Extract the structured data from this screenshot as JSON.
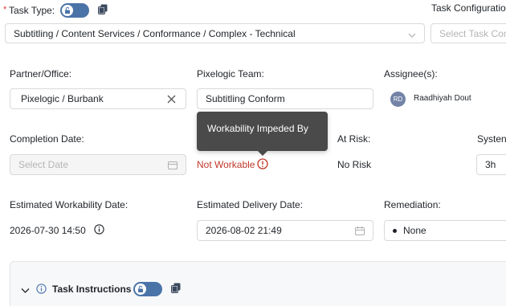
{
  "header": {
    "required_mark": "*",
    "task_type_label": "Task Type:",
    "task_config_label": "Task Configuratio"
  },
  "task_type": {
    "value": "Subtitling / Content Services / Conformance / Complex - Technical"
  },
  "task_config": {
    "placeholder": "Select Task Con"
  },
  "partner": {
    "label": "Partner/Office:",
    "value": "Pixelogic / Burbank"
  },
  "team": {
    "label": "Pixelogic Team:",
    "value": "Subtitling Conform"
  },
  "assignee": {
    "label": "Assignee(s):",
    "initials": "RD",
    "name": "Raadhiyah Dout"
  },
  "completion": {
    "label": "Completion Date:",
    "placeholder": "Select Date"
  },
  "workability": {
    "value": "Not Workable",
    "tooltip": "Workability Impeded By"
  },
  "at_risk": {
    "label": "At Risk:",
    "value": "No Risk"
  },
  "system": {
    "label": "Systen",
    "value": "3h"
  },
  "est_workability": {
    "label": "Estimated Workability Date:",
    "value": "2026-07-30 14:50"
  },
  "est_delivery": {
    "label": "Estimated Delivery Date:",
    "value": "2026-08-02 21:49"
  },
  "remediation": {
    "label": "Remediation:",
    "value": "None"
  },
  "instructions": {
    "title": "Task Instructions"
  },
  "colors": {
    "accent": "#4a73a8",
    "error": "#c0392b",
    "required": "#e53935"
  }
}
